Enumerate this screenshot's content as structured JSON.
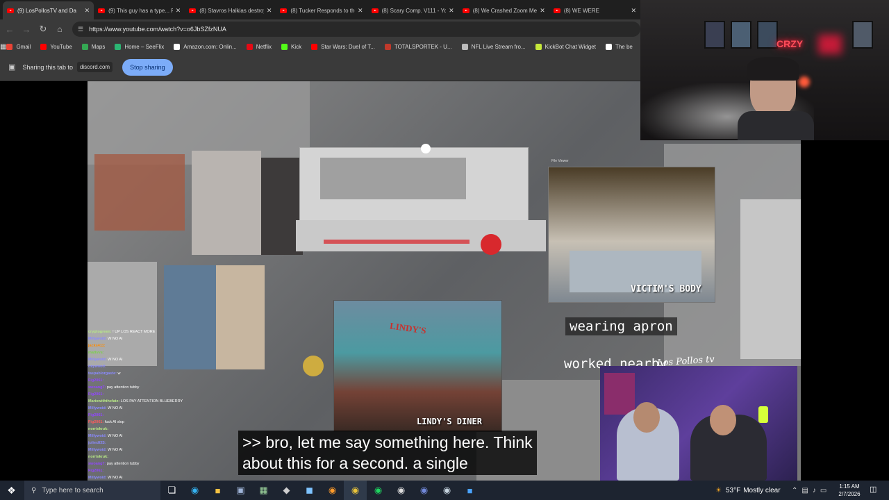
{
  "browser": {
    "tabs": [
      {
        "title": "(9) LosPollosTV and Da",
        "active": true
      },
      {
        "title": "(9) This guy has a type... Fi",
        "active": false
      },
      {
        "title": "(8) Stavros Halkias destroy",
        "active": false
      },
      {
        "title": "(8) Tucker Responds to the",
        "active": false
      },
      {
        "title": "(8) Scary Comp. V111 - Yo",
        "active": false
      },
      {
        "title": "(8) We Crashed Zoom Mee",
        "active": false
      },
      {
        "title": "(8) WE WERE",
        "active": false
      }
    ],
    "url": "https://www.youtube.com/watch?v=o6JbSZfzNUA",
    "bookmarks": [
      {
        "label": "Gmail",
        "icon": "gmail-icon",
        "color": "#ea4335"
      },
      {
        "label": "YouTube",
        "icon": "youtube-icon",
        "color": "#ff0000"
      },
      {
        "label": "Maps",
        "icon": "maps-icon",
        "color": "#34a853"
      },
      {
        "label": "Home – SeeFlix",
        "icon": "seeflix-icon",
        "color": "#2bb673"
      },
      {
        "label": "Amazon.com: Onlin...",
        "icon": "amazon-icon",
        "color": "#ffffff"
      },
      {
        "label": "Netflix",
        "icon": "netflix-icon",
        "color": "#e50914"
      },
      {
        "label": "Kick",
        "icon": "kick-icon",
        "color": "#53fc18"
      },
      {
        "label": "Star Wars: Duel of T...",
        "icon": "youtube-icon",
        "color": "#ff0000"
      },
      {
        "label": "TOTALSPORTEK - U...",
        "icon": "totalsportek-icon",
        "color": "#c0392b"
      },
      {
        "label": "NFL Live Stream fro...",
        "icon": "globe-icon",
        "color": "#bbbbbb"
      },
      {
        "label": "KickBot Chat Widget",
        "icon": "kickbot-icon",
        "color": "#c6e83a"
      },
      {
        "label": "The be",
        "icon": "diamond-icon",
        "color": "#ffffff"
      }
    ],
    "share": {
      "text": "Sharing this tab to",
      "domain": "discord.com",
      "stop_label": "Stop sharing"
    }
  },
  "video": {
    "overlay_labels": {
      "victims_body": "VICTIM'S BODY",
      "wearing_apron": "wearing apron",
      "worked_nearby": "worked nearby",
      "lindys_diner": "LINDY'S DINER",
      "lindys_sign": "LINDY'S",
      "signature": "Los Pollos tv",
      "file_viewer": "File Viewer"
    },
    "subtitle_lines": [
      ">> bro, let me say something here. Think",
      "about this for a second. a single"
    ],
    "chat": [
      {
        "user": "cryptogreen:",
        "msg": "! UP LOS REACT MORE",
        "color": "#b8e986"
      },
      {
        "user": "Millywoid:",
        "msg": "W NO AI",
        "color": "#8a8aff"
      },
      {
        "user": "jacks411:",
        "msg": "",
        "color": "#ff8c00"
      },
      {
        "user": "mattvvs:",
        "msg": "",
        "color": "#7bd14a"
      },
      {
        "user": "Millywoid:",
        "msg": "W NO AI",
        "color": "#8a8aff"
      },
      {
        "user": "daywood:",
        "msg": "",
        "color": "#8a8aff"
      },
      {
        "user": "taspablorgaste:",
        "msg": "w",
        "color": "#8a8aff"
      },
      {
        "user": "Fig2061:",
        "msg": "",
        "color": "#9146ff"
      },
      {
        "user": "swoang7:",
        "msg": "pay attention tubby",
        "color": "#9146ff"
      },
      {
        "user": "Fig2061:",
        "msg": "",
        "color": "#9146ff"
      },
      {
        "user": "Mariowiththefatz:",
        "msg": "LOS PAY ATTENTION BLUEBERRY",
        "color": "#b8e986"
      },
      {
        "user": "Millywoid:",
        "msg": "W NO AI",
        "color": "#8a8aff"
      },
      {
        "user": "Fig2061:",
        "msg": "",
        "color": "#9146ff"
      },
      {
        "user": "Fig2061:",
        "msg": "fuck AI slop",
        "color": "#ff5c5c"
      },
      {
        "user": "norriskruk:",
        "msg": "",
        "color": "#b8e986"
      },
      {
        "user": "Millywoid:",
        "msg": "W NO AI",
        "color": "#8a8aff"
      },
      {
        "user": "juliex83S:",
        "msg": "",
        "color": "#8a8aff"
      },
      {
        "user": "Millywoid:",
        "msg": "W NO AI",
        "color": "#8a8aff"
      },
      {
        "user": "norriskruk:",
        "msg": "",
        "color": "#b8e986"
      },
      {
        "user": "swoang7:",
        "msg": "pay attention tubby",
        "color": "#9146ff"
      },
      {
        "user": "Fig2061:",
        "msg": "",
        "color": "#9146ff"
      },
      {
        "user": "Millywoid:",
        "msg": "W NO AI",
        "color": "#8a8aff"
      },
      {
        "user": "mattvvs:",
        "msg": "",
        "color": "#7bd14a"
      }
    ]
  },
  "webcam": {
    "neon_sign": "CRZY"
  },
  "taskbar": {
    "search_placeholder": "Type here to search",
    "weather_temp": "53°F",
    "weather_desc": "Mostly clear",
    "time": "1:15 AM",
    "date": "2/7/2026",
    "notification_count": "2"
  }
}
